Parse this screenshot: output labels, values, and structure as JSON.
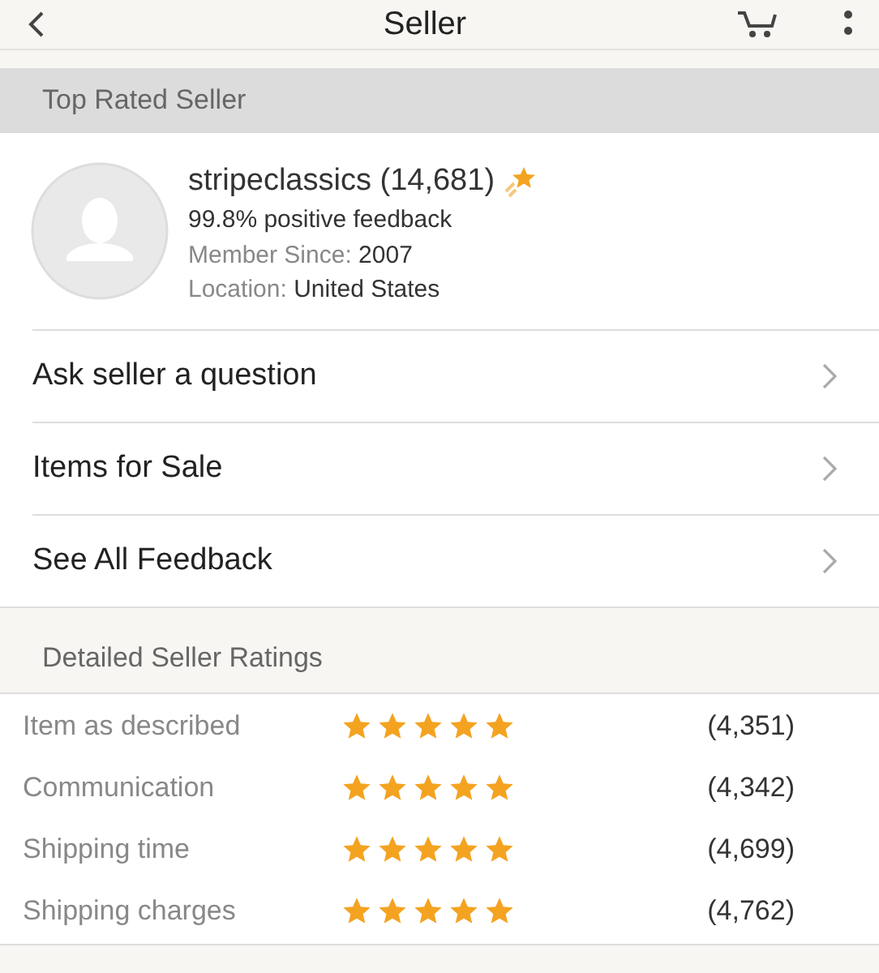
{
  "header": {
    "title": "Seller"
  },
  "badge_section": {
    "title": "Top Rated Seller"
  },
  "seller": {
    "name": "stripeclassics (14,681)",
    "feedback": "99.8% positive feedback",
    "member_since": {
      "label": "Member Since:",
      "value": "2007"
    },
    "location": {
      "label": "Location:",
      "value": "United States"
    }
  },
  "links": [
    {
      "label": "Ask seller a question"
    },
    {
      "label": "Items for Sale"
    },
    {
      "label": "See All Feedback"
    }
  ],
  "ratings": {
    "title": "Detailed Seller Ratings",
    "rows": [
      {
        "label": "Item as described",
        "stars": 5,
        "count": "(4,351)"
      },
      {
        "label": "Communication",
        "stars": 5,
        "count": "(4,342)"
      },
      {
        "label": "Shipping time",
        "stars": 5,
        "count": "(4,699)"
      },
      {
        "label": "Shipping charges",
        "stars": 5,
        "count": "(4,762)"
      }
    ]
  }
}
